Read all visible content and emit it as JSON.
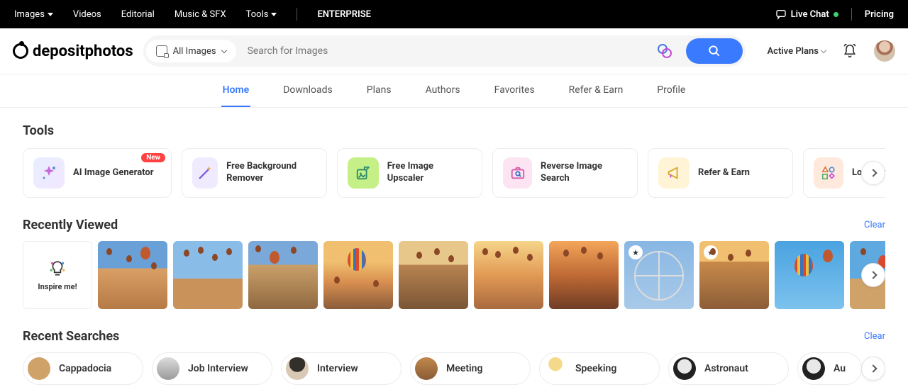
{
  "topbar": {
    "items": [
      "Images",
      "Videos",
      "Editorial",
      "Music & SFX",
      "Tools",
      "ENTERPRISE"
    ],
    "live_chat": "Live Chat",
    "pricing": "Pricing"
  },
  "brand": "depositphotos",
  "search": {
    "category_label": "All Images",
    "placeholder": "Search for Images"
  },
  "header": {
    "plans_label": "Active Plans"
  },
  "nav": {
    "tabs": [
      "Home",
      "Downloads",
      "Plans",
      "Authors",
      "Favorites",
      "Refer & Earn",
      "Profile"
    ],
    "active": "Home"
  },
  "tools": {
    "title": "Tools",
    "new_badge": "New",
    "items": [
      {
        "label": "AI Image Generator",
        "icon": "ai",
        "new": true
      },
      {
        "label": "Free Background Remover",
        "icon": "wand"
      },
      {
        "label": "Free Image Upscaler",
        "icon": "upscale"
      },
      {
        "label": "Reverse Image Search",
        "icon": "camera"
      },
      {
        "label": "Refer & Earn",
        "icon": "megaphone"
      },
      {
        "label": "Logo Maker",
        "icon": "shapes"
      }
    ]
  },
  "recently_viewed": {
    "title": "Recently Viewed",
    "clear": "Clear",
    "inspire_label": "Inspire me!"
  },
  "recent_searches": {
    "title": "Recent Searches",
    "clear": "Clear",
    "items": [
      {
        "label": "Cappadocia",
        "thumb": "cappa"
      },
      {
        "label": "Job Interview",
        "thumb": "interview"
      },
      {
        "label": "Interview",
        "thumb": "person"
      },
      {
        "label": "Meeting",
        "thumb": "meeting"
      },
      {
        "label": "Speeking",
        "thumb": "anime"
      },
      {
        "label": "Astronaut",
        "thumb": "astro"
      },
      {
        "label": "Au",
        "thumb": "astro"
      }
    ]
  }
}
